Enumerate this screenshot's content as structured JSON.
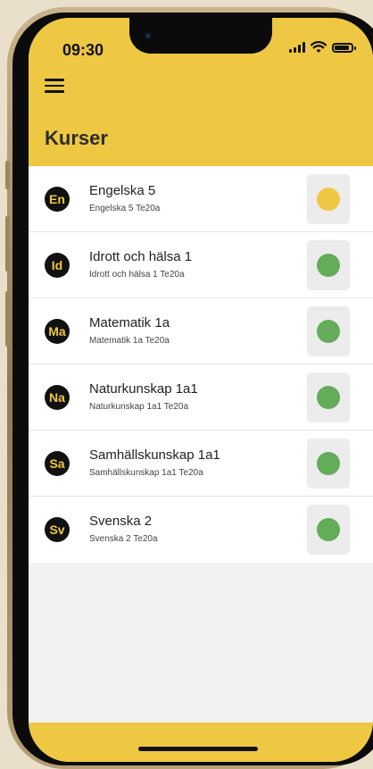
{
  "status_bar": {
    "time": "09:30"
  },
  "header": {
    "title": "Kurser",
    "menu_icon": "hamburger-menu-icon"
  },
  "colors": {
    "accent": "#eec843",
    "yellow_status": "#eec843",
    "green_status": "#64ab5a"
  },
  "courses": [
    {
      "badge": "En",
      "name": "Engelska 5",
      "group": "Engelska 5 Te20a",
      "status": "yellow"
    },
    {
      "badge": "Id",
      "name": "Idrott och hälsa 1",
      "group": "Idrott och hälsa 1 Te20a",
      "status": "green"
    },
    {
      "badge": "Ma",
      "name": "Matematik 1a",
      "group": "Matematik 1a Te20a",
      "status": "green"
    },
    {
      "badge": "Na",
      "name": "Naturkunskap 1a1",
      "group": "Naturkunskap 1a1 Te20a",
      "status": "green"
    },
    {
      "badge": "Sa",
      "name": "Samhällskunskap 1a1",
      "group": "Samhällskunskap 1a1 Te20a",
      "status": "green"
    },
    {
      "badge": "Sv",
      "name": "Svenska 2",
      "group": "Svenska 2 Te20a",
      "status": "green"
    }
  ]
}
